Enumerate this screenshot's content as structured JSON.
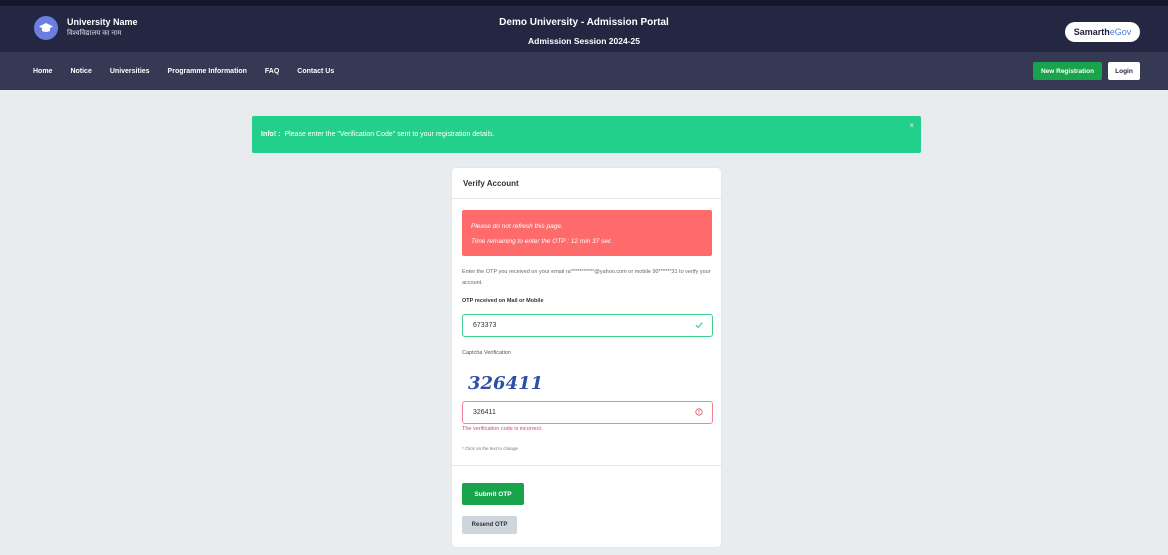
{
  "header": {
    "university_name": "University Name",
    "university_name_hindi": "विश्वविद्यालय का नाम",
    "portal_title": "Demo University - Admission Portal",
    "session": "Admission Session 2024-25",
    "brand_samarth": "Samarth",
    "brand_egov": "eGov"
  },
  "nav": {
    "items": [
      "Home",
      "Notice",
      "Universities",
      "Programme Information",
      "FAQ",
      "Contact Us"
    ],
    "new_registration": "New Registration",
    "login": "Login"
  },
  "info_alert": {
    "label": "Info! :",
    "message": "Please enter the \"Verification Code\" sent to your registration details.",
    "close": "×"
  },
  "card": {
    "title": "Verify Account",
    "warning_line1": "Please do not refresh this page.",
    "warning_line2": "Time remaining to enter the OTP : 12 min 37 sec",
    "description": "Enter the OTP you received on your email ra***********@yahoo.com or mobile 90******31 to verify your account.",
    "otp_label": "OTP received on Mail or Mobile",
    "otp_value": "673373",
    "captcha_label": "Captcha Verification",
    "captcha_image_text": "326411",
    "captcha_value": "326411",
    "captcha_error": "The verification code is incorrect.",
    "captcha_hint": "* Click on the text to change",
    "submit": "Submit OTP",
    "resend": "Resend OTP"
  },
  "colors": {
    "topbar": "#232742",
    "navbar": "#353954",
    "success": "#19a34a",
    "info_alert": "#22d08c",
    "warning": "#ff6b6b",
    "error": "#e0455d"
  }
}
